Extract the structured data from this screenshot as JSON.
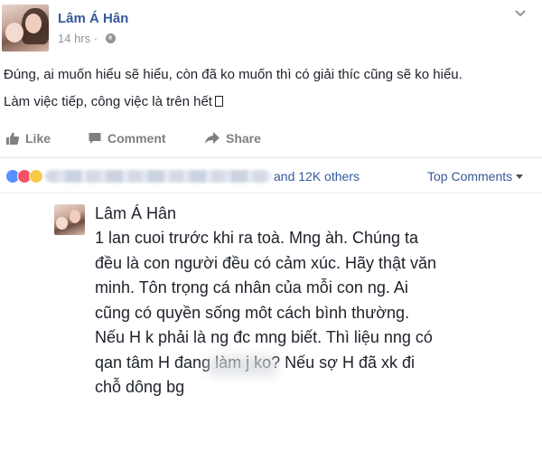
{
  "post": {
    "author": "Lâm Á Hân",
    "time": "14 hrs ·",
    "lines": [
      "Đúng, ai muốn hiểu sẽ hiểu, còn đã ko muốn thì có giải thíc cũng sẽ ko hiểu.",
      "Làm việc tiếp, công việc là trên hết"
    ]
  },
  "actions": {
    "like": "Like",
    "comment": "Comment",
    "share": "Share"
  },
  "reactions": {
    "others": "and 12K others",
    "top_comments": "Top Comments"
  },
  "comment": {
    "author": "Lâm Á Hân",
    "lines": [
      "1 lan cuoi trước khi ra toà. Mng àh. Chúng ta",
      "đều là con người đều có cảm xúc. Hãy thật văn",
      "minh. Tôn trọng cá nhân của mỗi con ng. Ai",
      "cũng có quyền sống môt cách bình thường.",
      "Nếu H k phải là ng đc mng biết. Thì liệu nng có",
      "qan tâm H đang làm j ko? Nếu sợ H đã xk đi",
      "chỗ dông bg"
    ]
  },
  "colors": {
    "link": "#365899",
    "text": "#1d2129",
    "muted": "#90949c"
  }
}
